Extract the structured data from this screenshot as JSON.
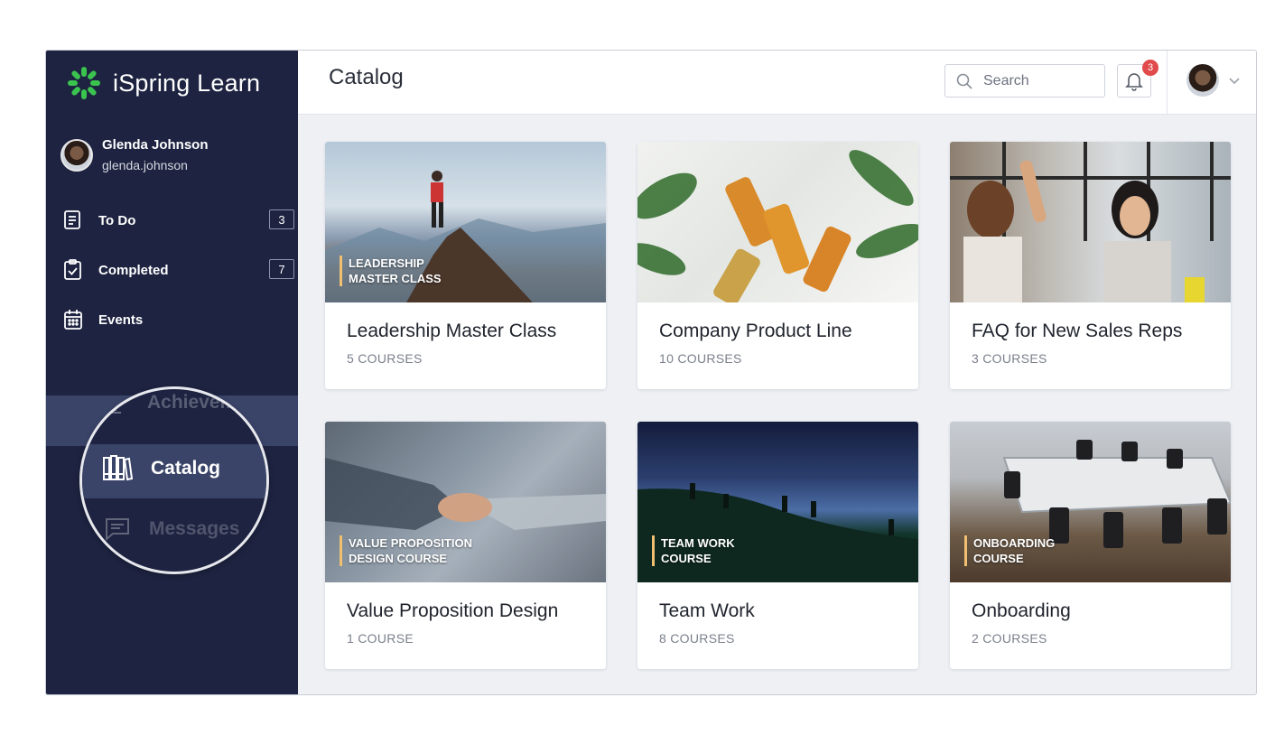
{
  "app": {
    "name": "iSpring Learn"
  },
  "user": {
    "name": "Glenda Johnson",
    "login": "glenda.johnson"
  },
  "sidebar": {
    "items": [
      {
        "label": "To Do",
        "count": "3"
      },
      {
        "label": "Completed",
        "count": "7"
      },
      {
        "label": "Events"
      }
    ],
    "magnified": {
      "achievements_label": "Achievements",
      "catalog_label": "Catalog",
      "messages_label": "Messages"
    }
  },
  "header": {
    "title": "Catalog",
    "search_placeholder": "Search",
    "notifications_count": "3"
  },
  "catalog": {
    "cards": [
      {
        "image_label": "LEADERSHIP\nMASTER CLASS",
        "title": "Leadership Master Class",
        "meta": "5 COURSES"
      },
      {
        "image_label": "",
        "title": "Company Product Line",
        "meta": "10 COURSES"
      },
      {
        "image_label": "",
        "title": "FAQ for New Sales Reps",
        "meta": "3 COURSES"
      },
      {
        "image_label": "VALUE PROPOSITION\nDESIGN COURSE",
        "title": "Value Proposition Design",
        "meta": "1 COURSE"
      },
      {
        "image_label": "TEAM WORK\nCOURSE",
        "title": "Team Work",
        "meta": "8 COURSES"
      },
      {
        "image_label": "ONBOARDING\nCOURSE",
        "title": "Onboarding",
        "meta": "2 COURSES"
      }
    ]
  },
  "colors": {
    "sidebar": "#1d2340",
    "active": "#3a4468",
    "accent": "#35c04a",
    "badge": "#e04a4a"
  }
}
